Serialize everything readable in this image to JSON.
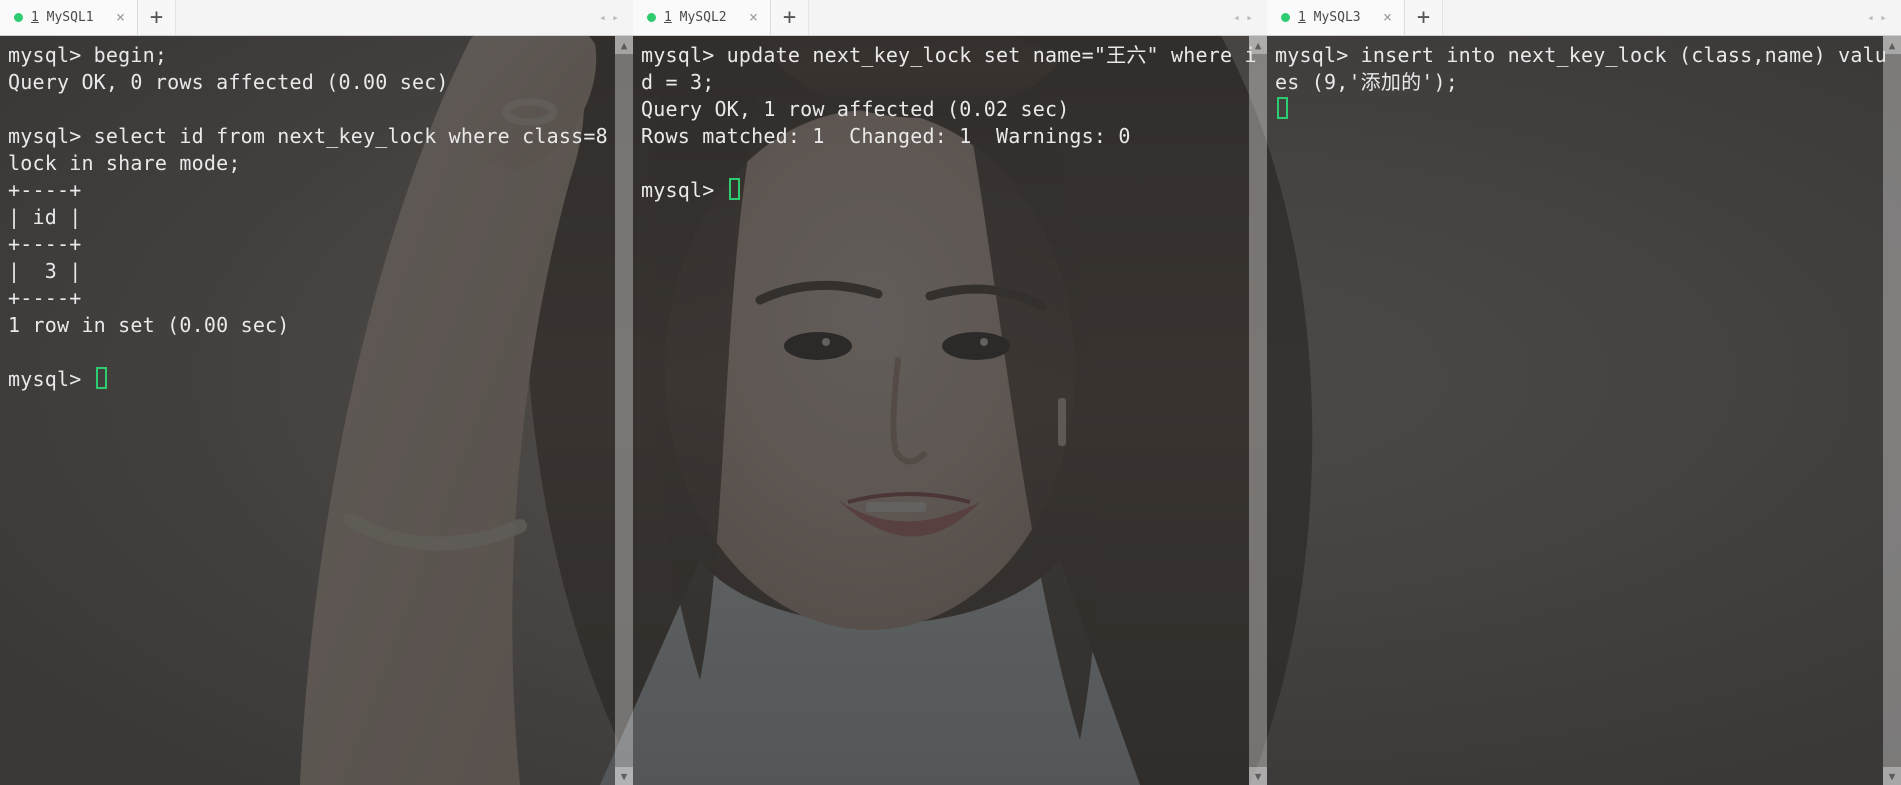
{
  "panes": [
    {
      "tab_prefix": "1",
      "tab_title": " MySQL1",
      "content": "mysql> begin;\nQuery OK, 0 rows affected (0.00 sec)\n\nmysql> select id from next_key_lock where class=8 lock in share mode;\n+----+\n| id |\n+----+\n|  3 |\n+----+\n1 row in set (0.00 sec)\n\nmysql> "
    },
    {
      "tab_prefix": "1",
      "tab_title": " MySQL2",
      "content": "mysql> update next_key_lock set name=\"王六\" where id = 3;\nQuery OK, 1 row affected (0.02 sec)\nRows matched: 1  Changed: 1  Warnings: 0\n\nmysql> "
    },
    {
      "tab_prefix": "1",
      "tab_title": " MySQL3",
      "content": "mysql> insert into next_key_lock (class,name) values (9,'添加的');\n"
    }
  ],
  "icons": {
    "close": "×",
    "plus": "+",
    "arrows": "◂ ▸",
    "up": "▲",
    "down": "▼"
  }
}
